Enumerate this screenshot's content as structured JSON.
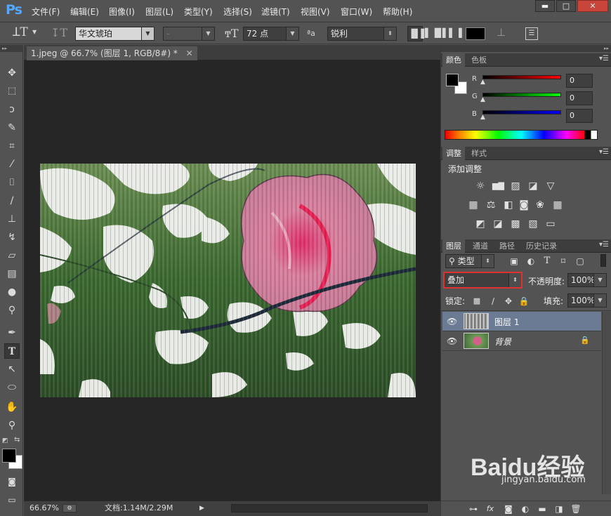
{
  "app": {
    "logo": "Ps"
  },
  "menu": [
    "文件(F)",
    "编辑(E)",
    "图像(I)",
    "图层(L)",
    "类型(Y)",
    "选择(S)",
    "滤镜(T)",
    "视图(V)",
    "窗口(W)",
    "帮助(H)"
  ],
  "window_controls": {
    "minimize": "▬",
    "maximize": "□",
    "close": "✕"
  },
  "options": {
    "font_family": "华文琥珀",
    "font_style": "-",
    "font_size": "72 点",
    "aa_label": "ªa",
    "antialias": "锐利",
    "text_color": "#000000"
  },
  "document": {
    "tab_title": "1.jpeg @ 66.7% (图层 1, RGB/8#) *",
    "zoom": "66.67%",
    "doc_size": "文档:1.14M/2.29M"
  },
  "color_panel": {
    "tabs": [
      "颜色",
      "色板"
    ],
    "channels": [
      {
        "label": "R",
        "value": "0"
      },
      {
        "label": "G",
        "value": "0"
      },
      {
        "label": "B",
        "value": "0"
      }
    ],
    "fg": "#000000",
    "bg": "#ffffff"
  },
  "adjust_panel": {
    "tabs": [
      "调整",
      "样式"
    ],
    "title": "添加调整"
  },
  "layers_panel": {
    "tabs": [
      "图层",
      "通道",
      "路径",
      "历史记录"
    ],
    "filter_kind": "类型",
    "blend_mode": "叠加",
    "opacity_label": "不透明度:",
    "opacity": "100%",
    "lock_label": "锁定:",
    "fill_label": "填充:",
    "fill": "100%",
    "layers": [
      {
        "name": "图层 1",
        "selected": true
      },
      {
        "name": "背景",
        "selected": false,
        "locked": true
      }
    ]
  },
  "watermark": {
    "brand": "Baidu经验",
    "url": "jingyan.baidu.com"
  }
}
